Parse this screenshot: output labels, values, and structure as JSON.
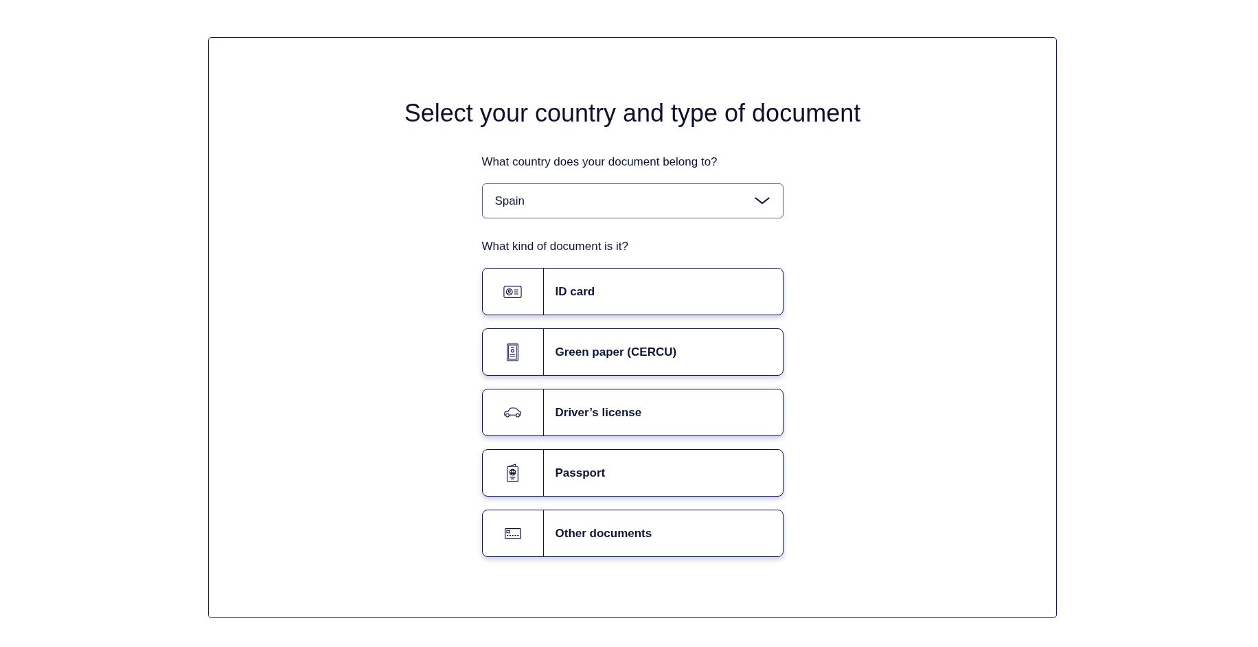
{
  "title": "Select your country and type of document",
  "country": {
    "label": "What country does your document belong to?",
    "value": "Spain"
  },
  "document_type": {
    "label": "What kind of document is it?",
    "options": [
      {
        "kind": "id_card",
        "label": "ID card"
      },
      {
        "kind": "green_paper",
        "label": "Green paper (CERCU)"
      },
      {
        "kind": "driver_license",
        "label": "Driver’s license"
      },
      {
        "kind": "passport",
        "label": "Passport"
      },
      {
        "kind": "other",
        "label": "Other documents"
      }
    ]
  }
}
